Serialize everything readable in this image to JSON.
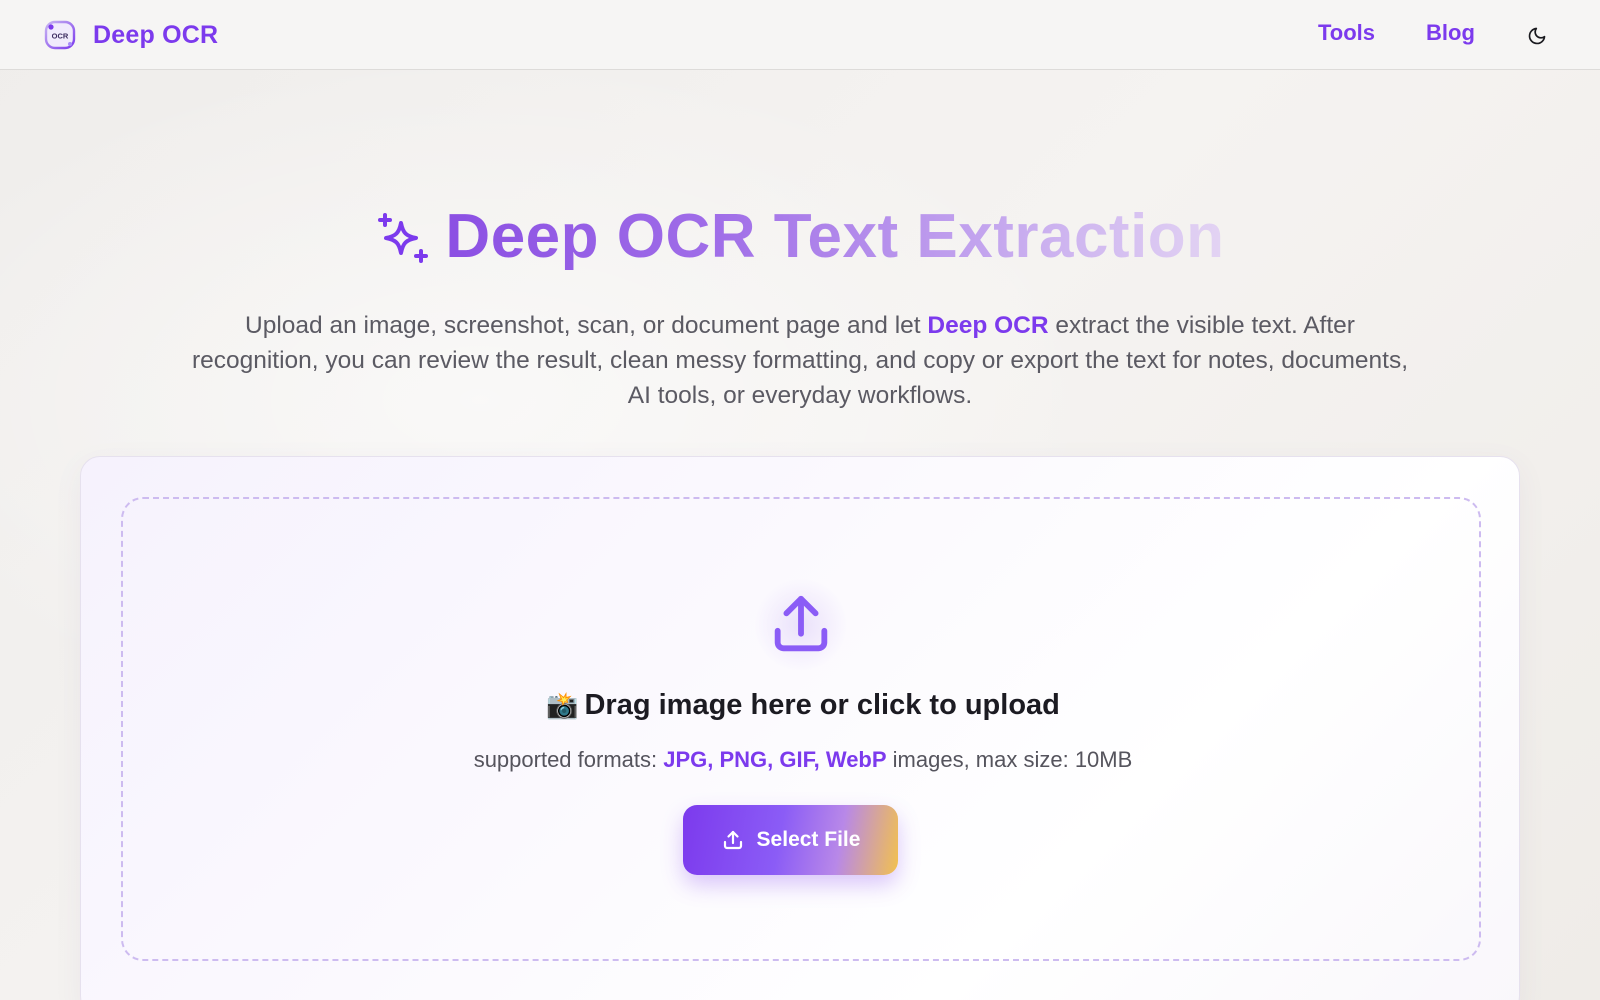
{
  "header": {
    "brand_name": "Deep OCR",
    "logo_icon": "ocr-logo-icon",
    "nav": [
      {
        "label": "Tools"
      },
      {
        "label": "Blog"
      }
    ],
    "theme_toggle_icon": "moon-icon"
  },
  "hero": {
    "title": "Deep OCR Text Extraction",
    "title_icon": "sparkles-icon",
    "desc_before": "Upload an image, screenshot, scan, or document page and let ",
    "desc_highlight": "Deep OCR",
    "desc_after": " extract the visible text. After recognition, you can review the result, clean messy formatting, and copy or export the text for notes, documents, AI tools, or everyday workflows."
  },
  "upload": {
    "icon": "upload-icon",
    "title_emoji": "📸",
    "title": "Drag image here or click to upload",
    "formats_prefix": "supported formats: ",
    "formats": "JPG, PNG, GIF, WebP",
    "formats_suffix": " images, max size: 10MB",
    "button_label": "Select File",
    "button_icon": "upload-icon"
  },
  "colors": {
    "accent": "#7c3aed",
    "button_gradient_end": "#f2c14e",
    "dashed_border": "#cdbbf0"
  }
}
